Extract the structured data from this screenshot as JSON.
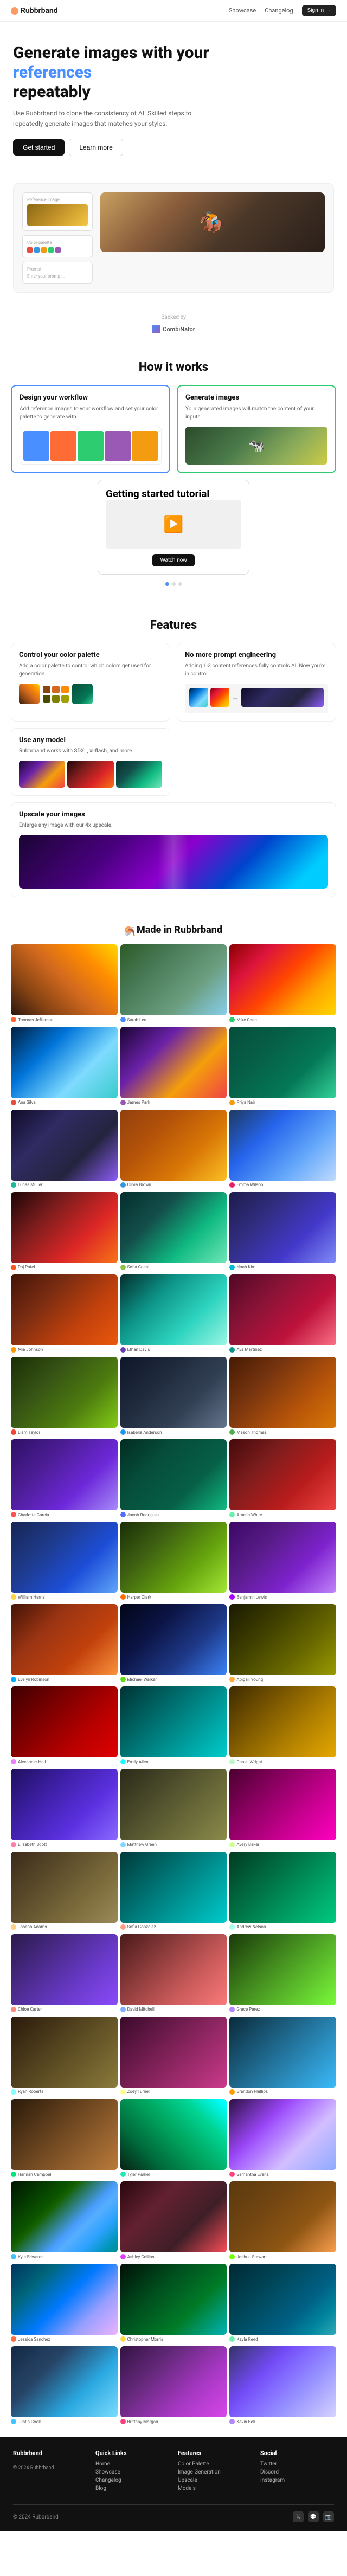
{
  "nav": {
    "logo": "Rubbrband",
    "links": [
      "Showcase",
      "Changelog"
    ],
    "cta": "Sign in →"
  },
  "hero": {
    "headline_line1": "Generate images with your",
    "headline_accent": "references",
    "headline_line2": "repeatably",
    "description": "Use Rubbrband to clone the consistency of AI. Skilled steps to repeatedly generate images that matches your styles.",
    "cta_primary": "Get started",
    "cta_secondary": "Learn more"
  },
  "powered_by": {
    "label": "Backed by",
    "logos": [
      "CombiNator"
    ]
  },
  "how_it_works": {
    "title": "How it works",
    "cards": [
      {
        "id": "design-workflow",
        "title": "Design your workflow",
        "description": "Add reference images to your workflow and set your color palette to generate with."
      },
      {
        "id": "generate-images",
        "title": "Generate images",
        "description": "Your generated images will match the content of your inputs."
      },
      {
        "id": "tutorial",
        "title": "Getting started tutorial",
        "btn": "Watch now"
      }
    ]
  },
  "features": {
    "title": "Features",
    "items": [
      {
        "id": "color-palette",
        "title": "Control your color palette",
        "description": "Add a color palette to control which colors get used for generation."
      },
      {
        "id": "no-prompt",
        "title": "No more prompt engineering",
        "description": "Adding 1-3 content references fully controls AI. Now you're in control."
      },
      {
        "id": "any-model",
        "title": "Use any model",
        "description": "Rubbrband works with SDXL, xl-flash, and more."
      },
      {
        "id": "upscale",
        "title": "Upscale your images",
        "description": "Enlarge any image with our 4x upscale."
      }
    ]
  },
  "made_in": {
    "title": "Made in Rubbrband",
    "icon": "🪃"
  },
  "gallery": {
    "items": [
      {
        "user": "Thomas Jefferson",
        "color": "#ff6b35"
      },
      {
        "user": "Sarah Lee",
        "color": "#4a8fff"
      },
      {
        "user": "Mike Chen",
        "color": "#2ecc71"
      },
      {
        "user": "Ana Silva",
        "color": "#e74c3c"
      },
      {
        "user": "James Park",
        "color": "#9b59b6"
      },
      {
        "user": "Priya Nair",
        "color": "#f39c12"
      },
      {
        "user": "Lucas Muller",
        "color": "#1abc9c"
      },
      {
        "user": "Olivia Brown",
        "color": "#3498db"
      },
      {
        "user": "Emma Wilson",
        "color": "#e91e63"
      },
      {
        "user": "Raj Patel",
        "color": "#ff5722"
      },
      {
        "user": "Sofia Costa",
        "color": "#8bc34a"
      },
      {
        "user": "Noah Kim",
        "color": "#00bcd4"
      },
      {
        "user": "Mia Johnson",
        "color": "#ff9800"
      },
      {
        "user": "Ethan Davis",
        "color": "#673ab7"
      },
      {
        "user": "Ava Martinez",
        "color": "#009688"
      },
      {
        "user": "Liam Taylor",
        "color": "#f44336"
      },
      {
        "user": "Isabella Anderson",
        "color": "#2196f3"
      },
      {
        "user": "Mason Thomas",
        "color": "#4caf50"
      },
      {
        "user": "Charlotte Garcia",
        "color": "#ff5252"
      },
      {
        "user": "Jacob Rodriguez",
        "color": "#536dfe"
      },
      {
        "user": "Amelia White",
        "color": "#69f0ae"
      },
      {
        "user": "William Harris",
        "color": "#ffd740"
      },
      {
        "user": "Harper Clark",
        "color": "#ff6d00"
      },
      {
        "user": "Benjamin Lewis",
        "color": "#aa00ff"
      },
      {
        "user": "Evelyn Robinson",
        "color": "#00b0ff"
      },
      {
        "user": "Michael Walker",
        "color": "#64dd17"
      },
      {
        "user": "Abigail Young",
        "color": "#ffab40"
      },
      {
        "user": "Alexander Hall",
        "color": "#ea80fc"
      },
      {
        "user": "Emily Allen",
        "color": "#18ffff"
      },
      {
        "user": "Daniel Wright",
        "color": "#b9f6ca"
      },
      {
        "user": "Elizabeth Scott",
        "color": "#ff80ab"
      },
      {
        "user": "Matthew Green",
        "color": "#80d8ff"
      },
      {
        "user": "Avery Baker",
        "color": "#ccff90"
      },
      {
        "user": "Joseph Adams",
        "color": "#ffd180"
      },
      {
        "user": "Sofia Gonzalez",
        "color": "#ff9e80"
      },
      {
        "user": "Andrew Nelson",
        "color": "#a7ffeb"
      },
      {
        "user": "Chloe Carter",
        "color": "#ff8a80"
      },
      {
        "user": "David Mitchell",
        "color": "#82b1ff"
      },
      {
        "user": "Grace Perez",
        "color": "#b388ff"
      },
      {
        "user": "Ryan Roberts",
        "color": "#84ffff"
      },
      {
        "user": "Zoey Turner",
        "color": "#ffff8d"
      },
      {
        "user": "Brandon Phillips",
        "color": "#ff9a00"
      },
      {
        "user": "Hannah Campbell",
        "color": "#00e676"
      },
      {
        "user": "Tyler Parker",
        "color": "#1de9b6"
      },
      {
        "user": "Samantha Evans",
        "color": "#ff4081"
      },
      {
        "user": "Kyle Edwards",
        "color": "#40c4ff"
      },
      {
        "user": "Ashley Collins",
        "color": "#e040fb"
      },
      {
        "user": "Joshua Stewart",
        "color": "#76ff03"
      },
      {
        "user": "Jessica Sanchez",
        "color": "#ff6e40"
      },
      {
        "user": "Christopher Morris",
        "color": "#ffd740"
      },
      {
        "user": "Kayla Reed",
        "color": "#69f0ae"
      },
      {
        "user": "Justin Cook",
        "color": "#40c4ff"
      },
      {
        "user": "Brittany Morgan",
        "color": "#ff4081"
      },
      {
        "user": "Kevin Bell",
        "color": "#b388ff"
      }
    ]
  },
  "footer": {
    "brand": "Rubbrband",
    "tagline": "© 2024 Rubbrband",
    "cols": [
      {
        "title": "Quick Links",
        "links": [
          "Home",
          "Showcase",
          "Changelog",
          "Blog"
        ]
      },
      {
        "title": "Features",
        "links": [
          "Color Palette",
          "Image Generation",
          "Upscale",
          "Models"
        ]
      },
      {
        "title": "Social",
        "links": [
          "Twitter",
          "Discord",
          "Instagram"
        ]
      }
    ],
    "social": [
      "𝕏",
      "💬",
      "📷"
    ]
  }
}
